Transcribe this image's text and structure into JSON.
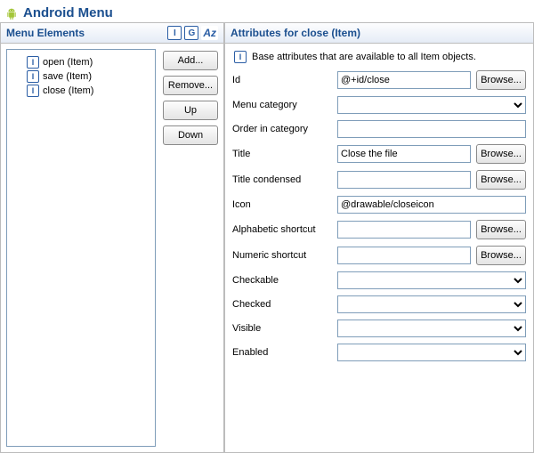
{
  "title": "Android Menu",
  "leftPanel": {
    "title": "Menu Elements",
    "icons": {
      "i": "I",
      "g": "G",
      "az": "Az"
    },
    "items": [
      {
        "label": "open (Item)"
      },
      {
        "label": "save (Item)"
      },
      {
        "label": "close (Item)"
      }
    ],
    "buttons": {
      "add": "Add...",
      "remove": "Remove...",
      "up": "Up",
      "down": "Down"
    }
  },
  "rightPanel": {
    "title": "Attributes for close (Item)",
    "desc": "Base attributes that are available to all Item objects.",
    "browse": "Browse...",
    "fields": {
      "id": {
        "label": "Id",
        "value": "@+id/close"
      },
      "menuCategory": {
        "label": "Menu category",
        "value": ""
      },
      "orderInCategory": {
        "label": "Order in category",
        "value": ""
      },
      "title": {
        "label": "Title",
        "value": "Close the file"
      },
      "titleCondensed": {
        "label": "Title condensed",
        "value": ""
      },
      "icon": {
        "label": "Icon",
        "value": "@drawable/closeicon"
      },
      "alphaShortcut": {
        "label": "Alphabetic shortcut",
        "value": ""
      },
      "numShortcut": {
        "label": "Numeric shortcut",
        "value": ""
      },
      "checkable": {
        "label": "Checkable",
        "value": ""
      },
      "checked": {
        "label": "Checked",
        "value": ""
      },
      "visible": {
        "label": "Visible",
        "value": ""
      },
      "enabled": {
        "label": "Enabled",
        "value": ""
      }
    }
  }
}
